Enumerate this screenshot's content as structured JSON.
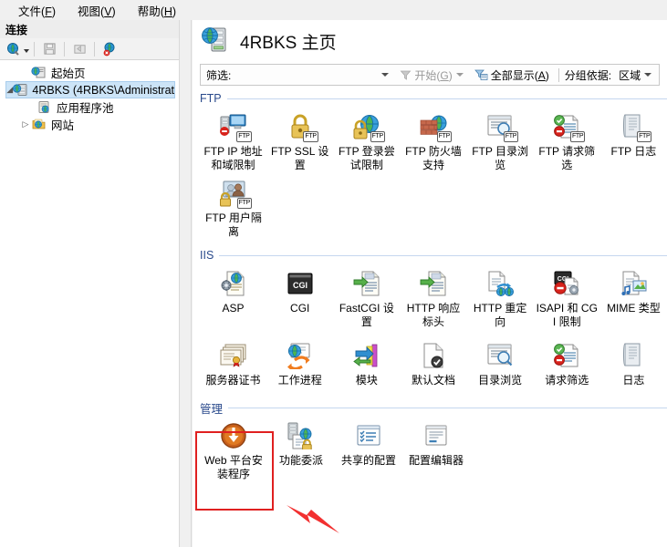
{
  "menubar": {
    "items": [
      {
        "label": "文件",
        "mnemonic": "F"
      },
      {
        "label": "视图",
        "mnemonic": "V"
      },
      {
        "label": "帮助",
        "mnemonic": "H"
      }
    ]
  },
  "connections": {
    "header": "连接",
    "toolbar": [
      {
        "name": "connect-to-dropdown",
        "icon": "globe-icon"
      },
      {
        "name": "save-connection-button",
        "icon": "save-disk-icon"
      },
      {
        "name": "export-connection-button",
        "icon": "export-icon"
      },
      {
        "name": "disconnect-button",
        "icon": "globe-disconnect-icon"
      }
    ],
    "tree": [
      {
        "label": "起始页",
        "icon": "start-page-icon",
        "expander": "",
        "selected": false,
        "indent": 1
      },
      {
        "label": "4RBKS (4RBKS\\Administrat",
        "icon": "server-icon",
        "expander": "▲",
        "selected": true,
        "indent": 0
      },
      {
        "label": "应用程序池",
        "icon": "app-pools-icon",
        "expander": "",
        "selected": false,
        "indent": 2
      },
      {
        "label": "网站",
        "icon": "sites-folder-icon",
        "expander": "▷",
        "selected": false,
        "indent": 1
      }
    ]
  },
  "page": {
    "title": "4RBKS 主页",
    "title_icon": "server-globe-icon"
  },
  "filterbar": {
    "filter_label": "筛选:",
    "filter_value": "",
    "filter_placeholder": "",
    "go_label": "开始",
    "go_mnemonic": "G",
    "show_all_label": "全部显示",
    "show_all_mnemonic": "A",
    "group_by_label": "分组依据:",
    "group_by_value": "区域"
  },
  "sections": [
    {
      "name": "FTP",
      "title": "FTP",
      "items": [
        {
          "label": "FTP IP 地址和域限制",
          "icon": "ftp-ip-address-restrictions-icon",
          "badge": "FTP"
        },
        {
          "label": "FTP SSL 设置",
          "icon": "ftp-ssl-settings-icon",
          "badge": "FTP"
        },
        {
          "label": "FTP 登录尝试限制",
          "icon": "ftp-logon-attempt-restrictions-icon",
          "badge": "FTP"
        },
        {
          "label": "FTP 防火墙支持",
          "icon": "ftp-firewall-support-icon",
          "badge": "FTP"
        },
        {
          "label": "FTP 目录浏览",
          "icon": "ftp-directory-browsing-icon",
          "badge": "FTP"
        },
        {
          "label": "FTP 请求筛选",
          "icon": "ftp-request-filtering-icon",
          "badge": "FTP"
        },
        {
          "label": "FTP 日志",
          "icon": "ftp-logging-icon",
          "badge": "FTP"
        },
        {
          "label": "FTP 用户隔离",
          "icon": "ftp-user-isolation-icon",
          "badge": "FTP"
        }
      ]
    },
    {
      "name": "IIS",
      "title": "IIS",
      "items": [
        {
          "label": "ASP",
          "icon": "asp-icon",
          "badge": ""
        },
        {
          "label": "CGI",
          "icon": "cgi-icon",
          "badge": ""
        },
        {
          "label": "FastCGI 设置",
          "icon": "fastcgi-settings-icon",
          "badge": ""
        },
        {
          "label": "HTTP 响应标头",
          "icon": "http-response-headers-icon",
          "badge": ""
        },
        {
          "label": "HTTP 重定向",
          "icon": "http-redirect-icon",
          "badge": ""
        },
        {
          "label": "ISAPI 和 CGI 限制",
          "icon": "isapi-cgi-restrictions-icon",
          "badge": ""
        },
        {
          "label": "MIME 类型",
          "icon": "mime-types-icon",
          "badge": ""
        },
        {
          "label": "服务器证书",
          "icon": "server-certificates-icon",
          "badge": ""
        },
        {
          "label": "工作进程",
          "icon": "worker-processes-icon",
          "badge": ""
        },
        {
          "label": "模块",
          "icon": "modules-icon",
          "badge": ""
        },
        {
          "label": "默认文档",
          "icon": "default-document-icon",
          "badge": ""
        },
        {
          "label": "目录浏览",
          "icon": "directory-browsing-icon",
          "badge": ""
        },
        {
          "label": "请求筛选",
          "icon": "request-filtering-icon",
          "badge": ""
        },
        {
          "label": "日志",
          "icon": "logging-icon",
          "badge": ""
        }
      ]
    },
    {
      "name": "管理",
      "title": "管理",
      "items": [
        {
          "label": "Web 平台安装程序",
          "icon": "web-platform-installer-icon",
          "badge": ""
        },
        {
          "label": "功能委派",
          "icon": "feature-delegation-icon",
          "badge": ""
        },
        {
          "label": "共享的配置",
          "icon": "shared-configuration-icon",
          "badge": ""
        },
        {
          "label": "配置编辑器",
          "icon": "configuration-editor-icon",
          "badge": ""
        }
      ]
    }
  ],
  "annotations": {
    "highlight_color": "#e02020",
    "highlight_target": "Web 平台安装程序",
    "arrow_color": "#f23030"
  }
}
